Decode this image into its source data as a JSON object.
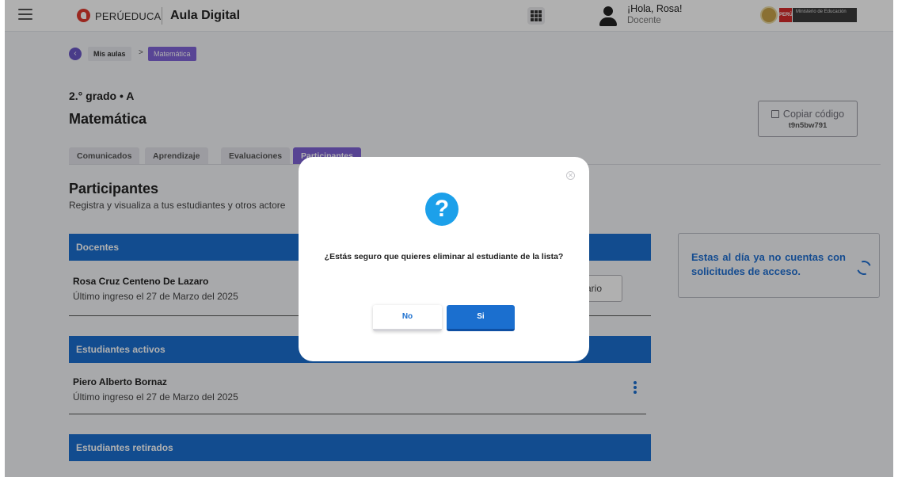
{
  "header": {
    "brand": "PERÚEDUCA",
    "app_name": "Aula Digital",
    "greeting": "¡Hola, Rosa!",
    "role": "Docente",
    "gov_peru": "PERÚ",
    "gov_ministry": "Ministerio de Educación"
  },
  "breadcrumb": {
    "back_icon": "chevron-left-icon",
    "item1": "Mis aulas",
    "separator": ">",
    "item2": "Matemática"
  },
  "course": {
    "grade": "2.° grado • A",
    "name": "Matemática",
    "copy_label": "Copiar código",
    "copy_code": "t9n5bw791"
  },
  "tabs": [
    "Comunicados",
    "Aprendizaje",
    "Evaluaciones",
    "Participantes"
  ],
  "participants": {
    "title": "Participantes",
    "description": "Registra y visualiza a tus estudiantes y otros actore",
    "teachers_header": "Docentes",
    "teacher_name": "Rosa Cruz Centeno De Lazaro",
    "teacher_last_login": "Último ingreso el 27 de Marzo del 2025",
    "teacher_button_partial": "ario",
    "active_header": "Estudiantes activos",
    "student_name": "Piero Alberto Bornaz",
    "student_last_login": "Último ingreso el 27 de Marzo del 2025",
    "retired_header": "Estudiantes retirados"
  },
  "side_card": {
    "message": "Estas al día ya no cuentas con solicitudes de acceso."
  },
  "modal": {
    "icon_glyph": "?",
    "message": "¿Estás seguro que quieres eliminar al estudiante de la lista?",
    "no_label": "No",
    "yes_label": "Si"
  },
  "colors": {
    "primary_blue": "#1b6fcf",
    "accent_purple": "#7e63d6",
    "info_blue": "#1ca0ea"
  }
}
